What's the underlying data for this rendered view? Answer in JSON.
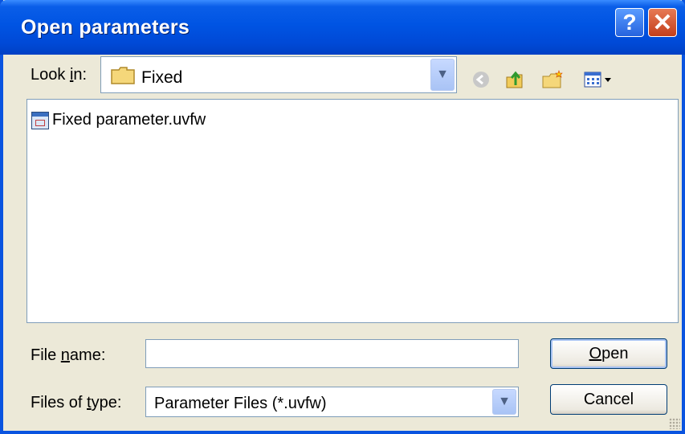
{
  "window": {
    "title": "Open parameters"
  },
  "titlebar": {
    "help_glyph": "?",
    "close_glyph": "✕"
  },
  "lookin": {
    "label_prefix": "Look ",
    "label_accel": "i",
    "label_suffix": "n:",
    "value": "Fixed",
    "folder_icon": "folder-icon"
  },
  "toolbar": {
    "back_icon": "back-arrow-icon",
    "up_icon": "up-folder-icon",
    "new_folder_icon": "new-folder-icon",
    "views_icon": "views-menu-icon"
  },
  "files": [
    {
      "name": "Fixed parameter.uvfw",
      "icon": "parameter-file-icon"
    }
  ],
  "filename": {
    "label_prefix": "File ",
    "label_accel": "n",
    "label_suffix": "ame:",
    "value": ""
  },
  "filetype": {
    "label_prefix": "Files of ",
    "label_accel": "t",
    "label_suffix": "ype:",
    "value": "Parameter Files  (*.uvfw)"
  },
  "buttons": {
    "open_accel": "O",
    "open_rest": "pen",
    "cancel": "Cancel"
  },
  "colors": {
    "titlebar": "#0054e3",
    "dialog_bg": "#ece9d8",
    "close": "#c33f1c"
  }
}
